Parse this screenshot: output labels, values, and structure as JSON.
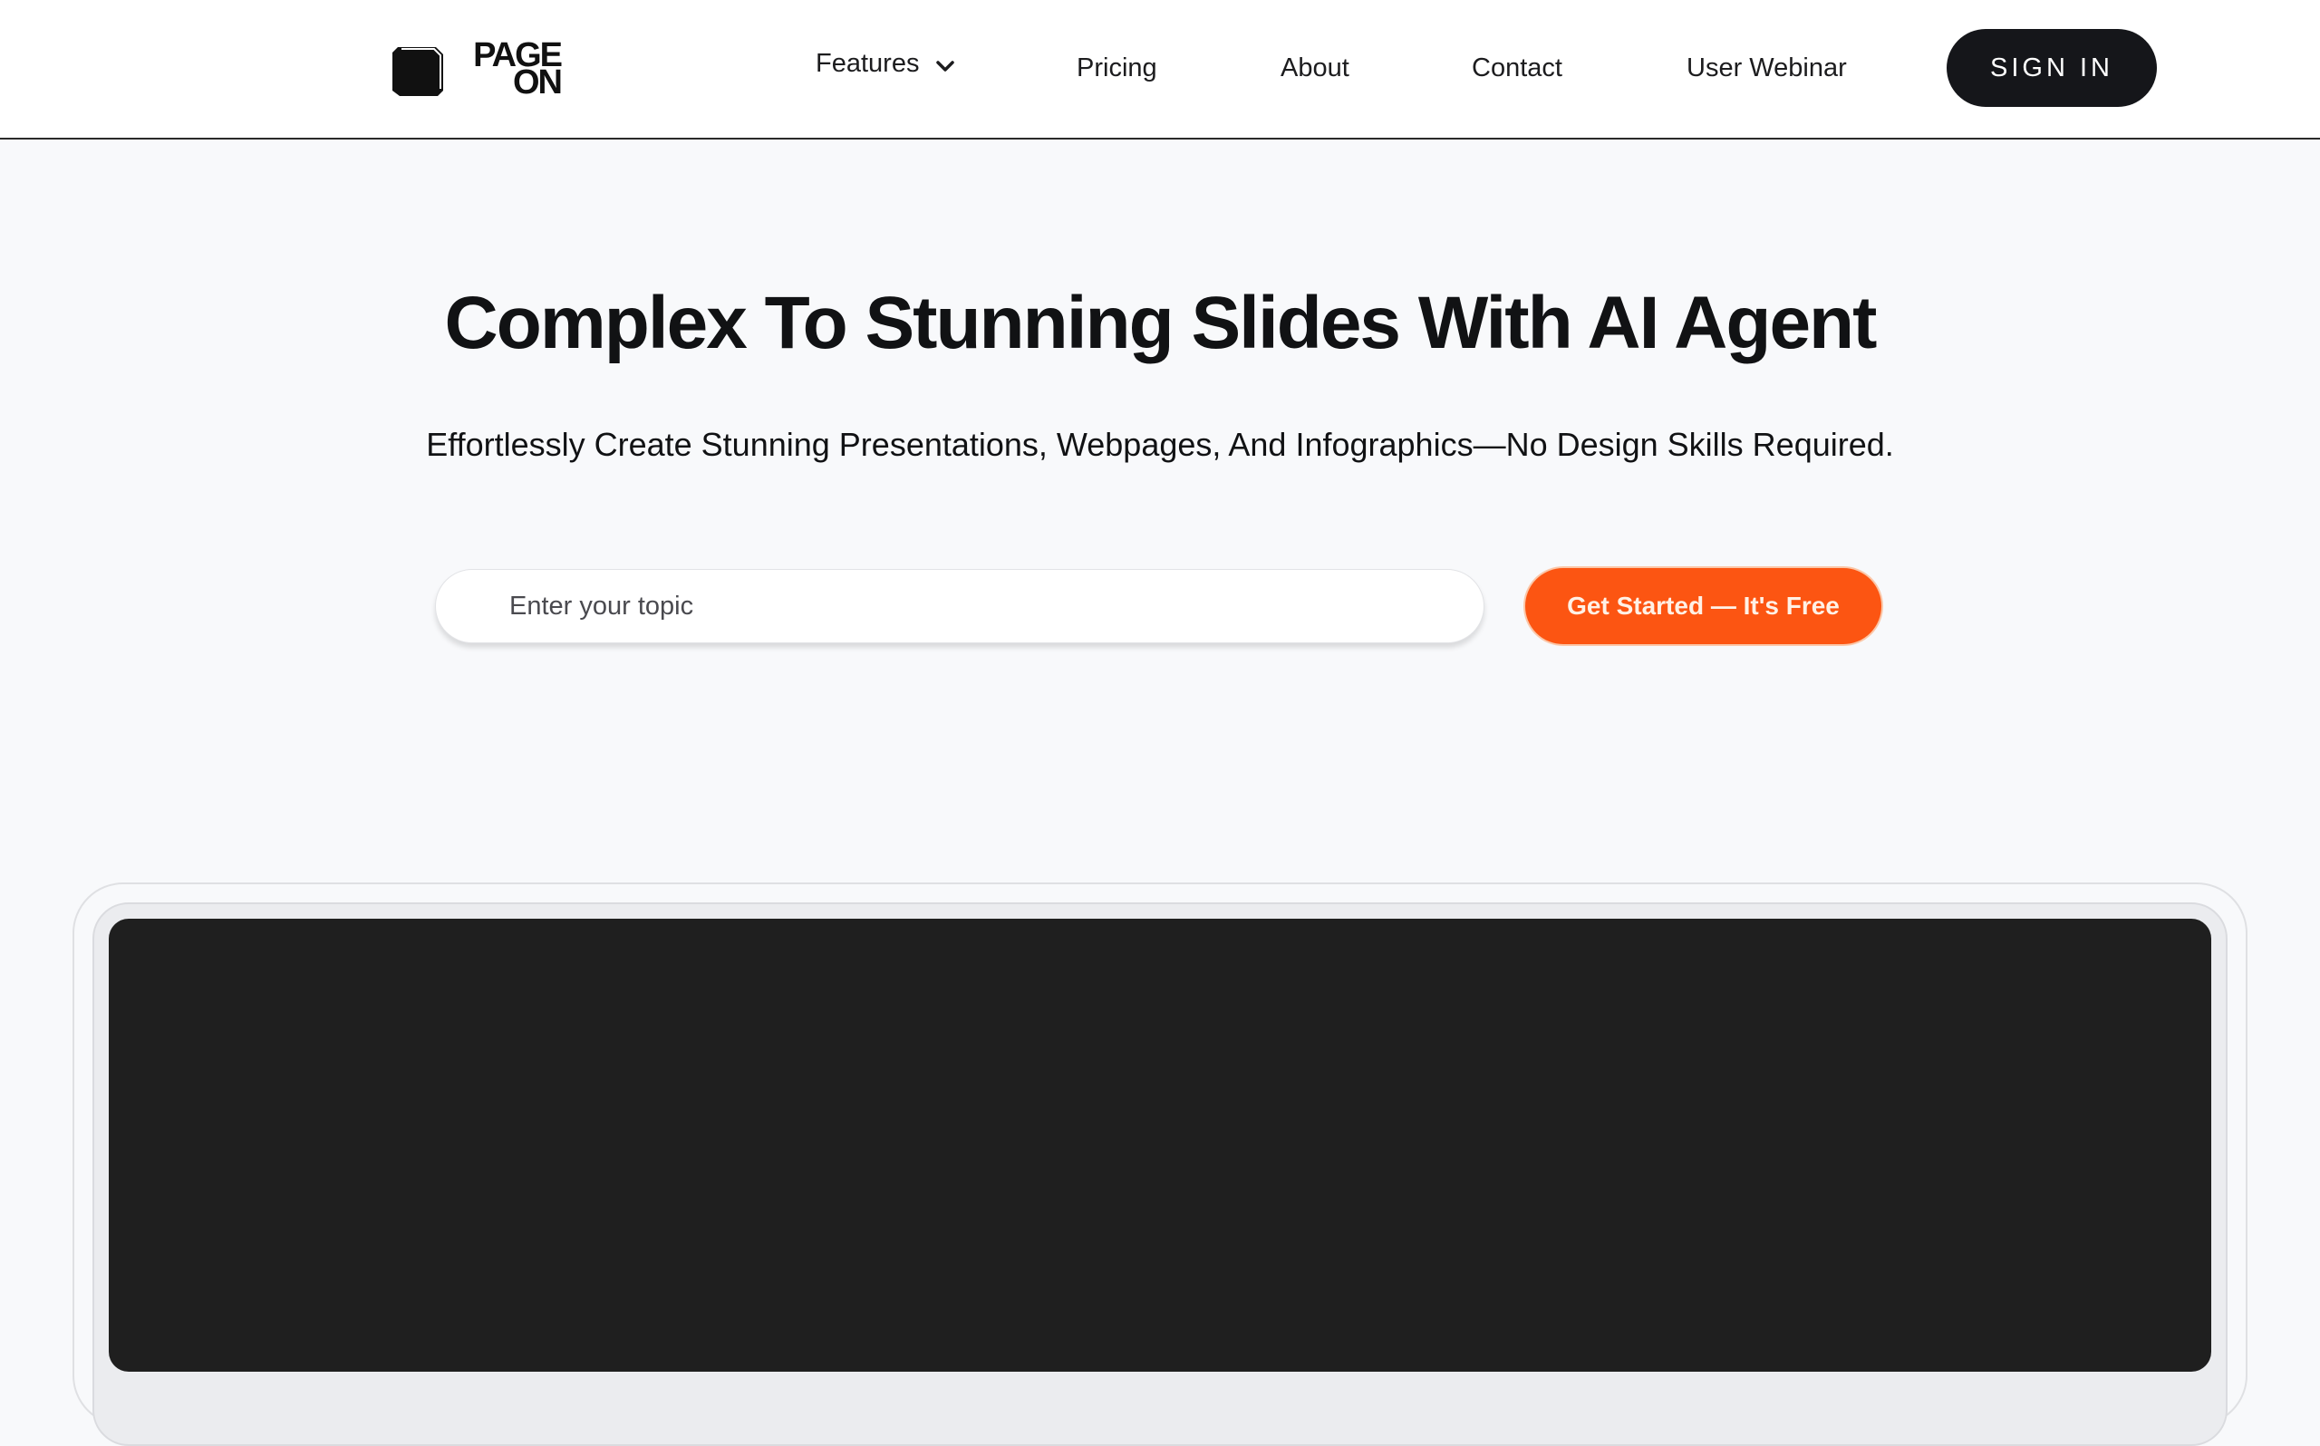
{
  "header": {
    "logo": {
      "line1": "PAGE",
      "line2": "ON",
      "icon": "cube-icon"
    },
    "nav": [
      {
        "label": "Features",
        "has_dropdown": true,
        "icon": "chevron-down-icon"
      },
      {
        "label": "Pricing"
      },
      {
        "label": "About"
      },
      {
        "label": "Contact"
      },
      {
        "label": "User Webinar"
      }
    ],
    "sign_in_label": "SIGN IN"
  },
  "hero": {
    "title": "Complex To Stunning Slides With AI Agent",
    "subtitle": "Effortlessly Create Stunning Presentations, Webpages, And Infographics—No Design Skills Required.",
    "topic_input": {
      "value": "",
      "placeholder": "Enter your topic"
    },
    "cta_label": "Get Started — It's Free"
  },
  "colors": {
    "accent": "#fc5512",
    "dark": "#15161a",
    "background": "#f8f9fb",
    "preview_panel": "#1f1f1f"
  }
}
